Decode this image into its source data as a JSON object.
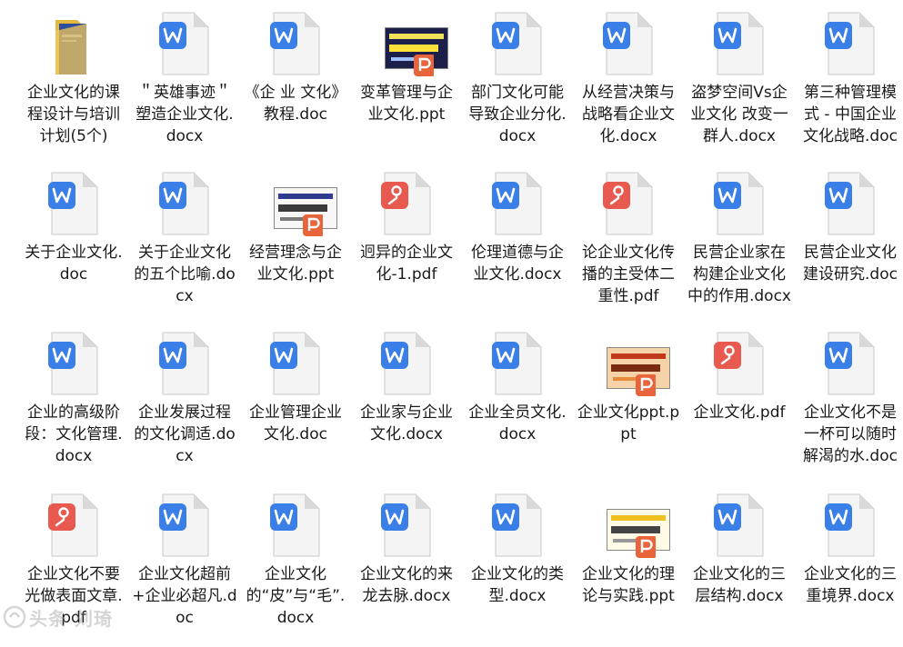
{
  "colors": {
    "word": "#3a7ee8",
    "pdf": "#e85a50",
    "ppt": "#e8643a",
    "folder": "#f1c75a",
    "page": "#f4f4f4",
    "page_fold": "#d9d9d9"
  },
  "files": [
    {
      "label": "企业文化的课程设计与培训计划(5个)",
      "type": "folder",
      "icon": "folder-icon"
    },
    {
      "label": "＂英雄事迹＂塑造企业文化.docx",
      "type": "word",
      "icon": "word-doc-icon"
    },
    {
      "label": "《企 业 文化》教程.doc",
      "type": "word",
      "icon": "word-doc-icon"
    },
    {
      "label": "变革管理与企业文化.ppt",
      "type": "ppt-thumb",
      "icon": "ppt-thumbnail-icon",
      "thumb": "dark"
    },
    {
      "label": "部门文化可能导致企业分化.docx",
      "type": "word",
      "icon": "word-doc-icon"
    },
    {
      "label": "从经营决策与战略看企业文化.docx",
      "type": "word",
      "icon": "word-doc-icon"
    },
    {
      "label": "盗梦空间Vs企业文化 改变一群人.docx",
      "type": "word",
      "icon": "word-doc-icon"
    },
    {
      "label": "第三种管理模式 - 中国企业文化战略.doc",
      "type": "word",
      "icon": "word-doc-icon"
    },
    {
      "label": "关于企业文化.doc",
      "type": "word",
      "icon": "word-doc-icon"
    },
    {
      "label": "关于企业文化的五个比喻.docx",
      "type": "word",
      "icon": "word-doc-icon"
    },
    {
      "label": "经营理念与企业文化.ppt",
      "type": "ppt-thumb",
      "icon": "ppt-thumbnail-icon",
      "thumb": "light"
    },
    {
      "label": "迥异的企业文化-1.pdf",
      "type": "pdf",
      "icon": "pdf-doc-icon"
    },
    {
      "label": "伦理道德与企业文化.docx",
      "type": "word",
      "icon": "word-doc-icon"
    },
    {
      "label": "论企业文化传播的主受体二重性.pdf",
      "type": "pdf",
      "icon": "pdf-doc-icon"
    },
    {
      "label": "民营企业家在构建企业文化中的作用.docx",
      "type": "word",
      "icon": "word-doc-icon"
    },
    {
      "label": "民营企业文化建设研究.doc",
      "type": "word",
      "icon": "word-doc-icon"
    },
    {
      "label": "企业的高级阶段：文化管理.docx",
      "type": "word",
      "icon": "word-doc-icon"
    },
    {
      "label": "企业发展过程的文化调适.docx",
      "type": "word",
      "icon": "word-doc-icon"
    },
    {
      "label": "企业管理企业文化.doc",
      "type": "word",
      "icon": "word-doc-icon"
    },
    {
      "label": "企业家与企业文化.docx",
      "type": "word",
      "icon": "word-doc-icon"
    },
    {
      "label": "企业全员文化.docx",
      "type": "word",
      "icon": "word-doc-icon"
    },
    {
      "label": "企业文化ppt.ppt",
      "type": "ppt-thumb",
      "icon": "ppt-thumbnail-icon",
      "thumb": "orange"
    },
    {
      "label": "企业文化.pdf",
      "type": "pdf",
      "icon": "pdf-doc-icon"
    },
    {
      "label": "企业文化不是一杯可以随时解渴的水.doc",
      "type": "word",
      "icon": "word-doc-icon"
    },
    {
      "label": "企业文化不要光做表面文章.pdf",
      "type": "pdf",
      "icon": "pdf-doc-icon"
    },
    {
      "label": "企业文化超前+企业必超凡.doc",
      "type": "word",
      "icon": "word-doc-icon"
    },
    {
      "label": "企业文化的“皮”与“毛”.docx",
      "type": "word",
      "icon": "word-doc-icon"
    },
    {
      "label": "企业文化的来龙去脉.docx",
      "type": "word",
      "icon": "word-doc-icon"
    },
    {
      "label": "企业文化的类型.docx",
      "type": "word",
      "icon": "word-doc-icon"
    },
    {
      "label": "企业文化的理论与实践.ppt",
      "type": "ppt-thumb",
      "icon": "ppt-thumbnail-icon",
      "thumb": "yellow"
    },
    {
      "label": "企业文化的三层结构.docx",
      "type": "word",
      "icon": "word-doc-icon"
    },
    {
      "label": "企业文化的三重境界.docx",
      "type": "word",
      "icon": "word-doc-icon"
    }
  ],
  "watermark": {
    "text": "头条 刘琦"
  }
}
